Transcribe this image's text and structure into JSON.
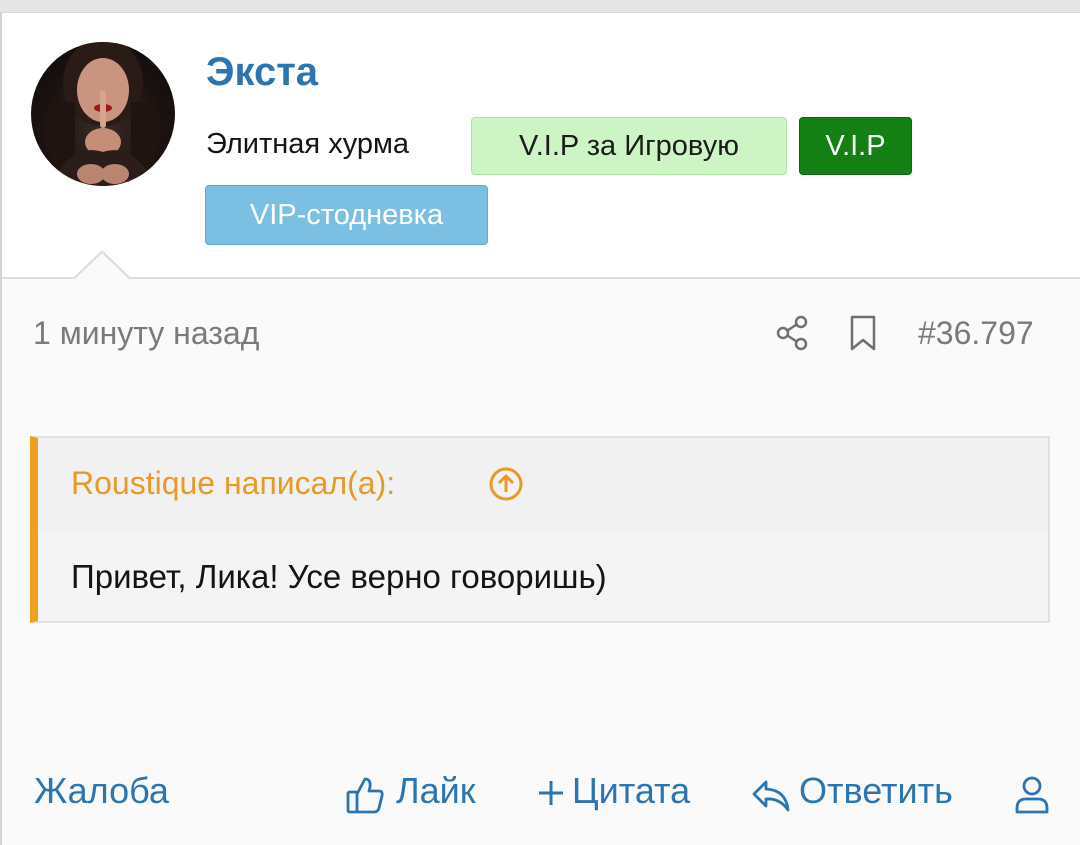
{
  "user": {
    "name": "Экста",
    "title": "Элитная хурма",
    "badges": [
      "V.I.P за Игровую",
      "V.I.P",
      "VIP-стодневка"
    ]
  },
  "post": {
    "time": "1 минуту назад",
    "number": "#36.797"
  },
  "quote": {
    "author_label": "Roustique написал(а):",
    "text": "Привет, Лика! Усе верно говоришь)"
  },
  "actions": {
    "report": "Жалоба",
    "like": "Лайк",
    "quote": "Цитата",
    "reply": "Ответить"
  },
  "colors": {
    "accent": "#2b75b1",
    "quote_border": "#f0a020",
    "quote_author": "#e89a26",
    "badge_green_light": "#cdf4c5",
    "badge_green_dark": "#128012",
    "badge_blue": "#7bc0e3"
  },
  "icons": [
    "share-icon",
    "bookmark-icon",
    "arrow-up-circle-icon",
    "thumbs-up-icon",
    "plus-icon",
    "reply-icon",
    "user-icon"
  ]
}
